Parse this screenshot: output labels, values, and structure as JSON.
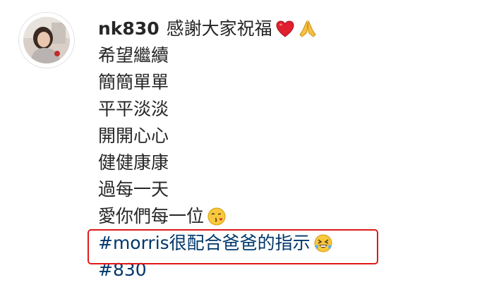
{
  "post": {
    "username": "nk830",
    "caption_lines": [
      "感謝大家祝福",
      "希望繼續",
      "簡簡單單",
      "平平淡淡",
      "開開心心",
      "健健康康",
      "過每一天",
      "愛你們每一位"
    ],
    "hashtags": [
      "#morris很配合爸爸的指示",
      "#830"
    ]
  },
  "emojis": {
    "line1": [
      "red-heart-icon",
      "folded-hands-icon"
    ],
    "line8": [
      "face-blowing-kiss-icon"
    ],
    "hashtag1": [
      "rolling-laughing-face-icon"
    ]
  },
  "colors": {
    "text": "#262626",
    "hashtag": "#00376b",
    "highlight": "#e01919"
  }
}
